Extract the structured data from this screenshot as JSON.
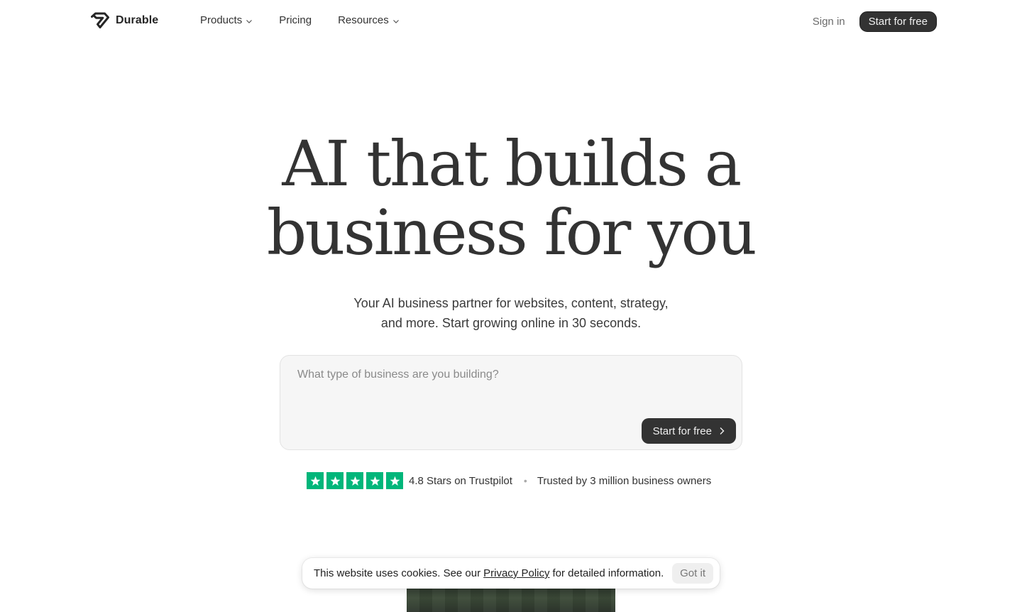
{
  "header": {
    "brand": "Durable",
    "nav": [
      {
        "label": "Products",
        "has_dropdown": true
      },
      {
        "label": "Pricing",
        "has_dropdown": false
      },
      {
        "label": "Resources",
        "has_dropdown": true
      }
    ],
    "signin_label": "Sign in",
    "cta_label": "Start for free"
  },
  "hero": {
    "title_line1": "AI that builds a",
    "title_line2": "business for you",
    "subtitle_line1": "Your AI business partner for websites, content, strategy,",
    "subtitle_line2": "and more. Start growing online in 30 seconds."
  },
  "prompt": {
    "placeholder": "What type of business are you building?",
    "value": "",
    "button_label": "Start for free"
  },
  "rating": {
    "stars": 5,
    "stars_text": "4.8 Stars on Trustpilot",
    "separator": "•",
    "trusted_text": "Trusted by 3 million business owners"
  },
  "cookie": {
    "text_before": "This website uses cookies. See our",
    "link_label": "Privacy Policy",
    "text_after": "for detailed information.",
    "button_label": "Got it"
  },
  "colors": {
    "accent_dark": "#333333",
    "trustpilot_green": "#00b67a",
    "prompt_bg": "#f6f6f6"
  },
  "icons": {
    "logo": "diamond-logo-icon",
    "dropdown": "chevron-down-icon",
    "arrow": "chevron-right-icon",
    "star": "star-icon"
  }
}
